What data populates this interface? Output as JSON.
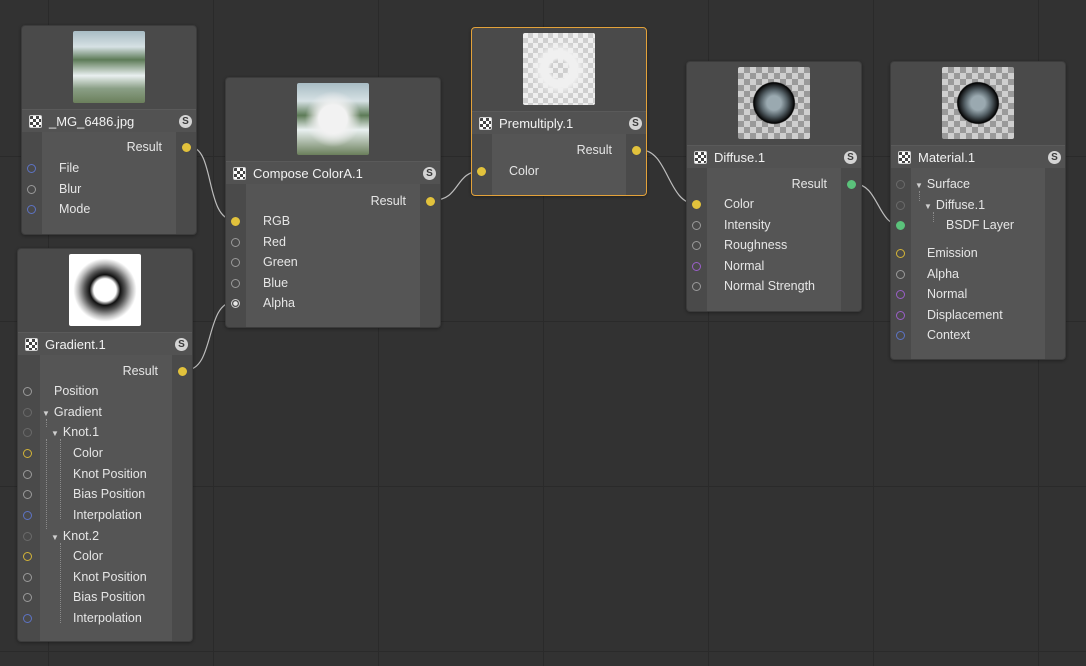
{
  "colors": {
    "port_yellow": "#e2c23c",
    "port_green": "#5bc27b",
    "port_blue": "#5d73c4",
    "port_purple": "#9a5fc8",
    "selection": "#e3a23a"
  },
  "nodes": {
    "image": {
      "title": "_MG_6486.jpg",
      "badge": "S",
      "result": "Result",
      "inputs": [
        "File",
        "Blur",
        "Mode"
      ]
    },
    "gradient": {
      "title": "Gradient.1",
      "badge": "S",
      "result": "Result",
      "inputs": [
        "Position",
        "Gradient",
        "Knot.1",
        "Color",
        "Knot Position",
        "Bias Position",
        "Interpolation",
        "Knot.2",
        "Color",
        "Knot Position",
        "Bias Position",
        "Interpolation"
      ]
    },
    "compose": {
      "title": "Compose ColorA.1",
      "badge": "S",
      "result": "Result",
      "inputs": [
        "RGB",
        "Red",
        "Green",
        "Blue",
        "Alpha"
      ]
    },
    "premultiply": {
      "title": "Premultiply.1",
      "badge": "S",
      "result": "Result",
      "inputs": [
        "Color"
      ]
    },
    "diffuse": {
      "title": "Diffuse.1",
      "badge": "S",
      "result": "Result",
      "inputs": [
        "Color",
        "Intensity",
        "Roughness",
        "Normal",
        "Normal Strength"
      ]
    },
    "material": {
      "title": "Material.1",
      "badge": "S",
      "inputs": [
        "Surface",
        "Diffuse.1",
        "BSDF Layer",
        "Emission",
        "Alpha",
        "Normal",
        "Displacement",
        "Context"
      ]
    }
  }
}
